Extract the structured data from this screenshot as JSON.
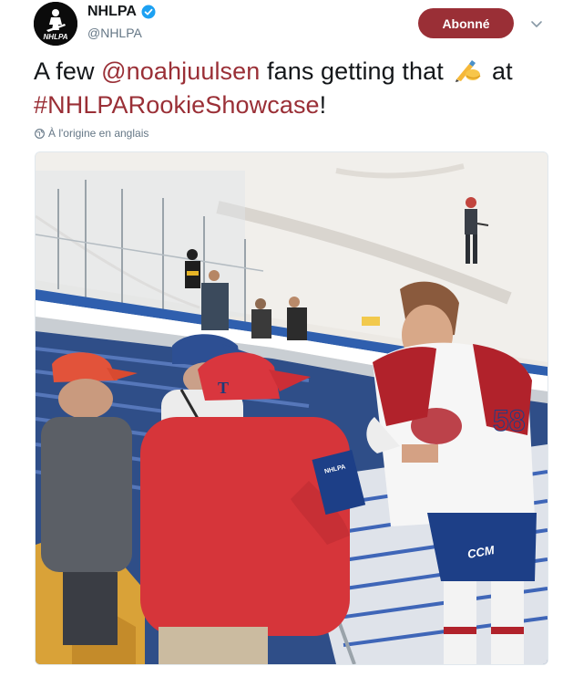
{
  "account": {
    "display_name": "NHLPA",
    "handle": "@NHLPA",
    "verified": true,
    "avatar_icon": "nhlpa-logo-icon"
  },
  "follow_button": {
    "label": "Abonné",
    "color": "#9a2f36"
  },
  "menu": {
    "icon": "chevron-down-icon"
  },
  "tweet": {
    "text_before": "A few ",
    "mention": "@noahjuulsen",
    "text_middle": " fans getting that ",
    "emoji": "✍",
    "emoji_icon": "writing-hand-icon",
    "text_after": " at ",
    "hashtag": "#NHLPARookieShowcase",
    "text_end": "!",
    "link_color": "#9a2f36"
  },
  "translation": {
    "label": "À l'origine en anglais",
    "icon": "globe-icon"
  },
  "media": {
    "jersey_number": "58",
    "card_text": "NHLPA",
    "ccm_text": "CCM"
  }
}
